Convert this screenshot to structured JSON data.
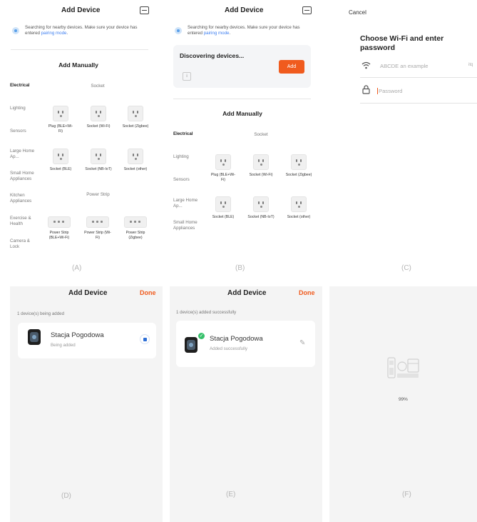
{
  "panel_a": {
    "title": "Add Device",
    "search_text": "Searching for nearby devices. Make sure your device has entered ",
    "pairing_link": "pairing mode",
    "period": ".",
    "add_manually": "Add Manually",
    "categories": [
      "Electrical",
      "Lighting",
      "Sensors",
      "Large Home Ap...",
      "Small Home Appliances",
      "Kitchen Appliances",
      "Exercise & Health",
      "Camera & Lock"
    ],
    "socket_header": "Socket",
    "power_strip_header": "Power Strip",
    "sockets": [
      "Plug (BLE+Wi-Fi)",
      "Socket (Wi-Fi)",
      "Socket (Zigbee)",
      "Socket (BLE)",
      "Socket (NB-IoT)",
      "Socket (other)"
    ],
    "strips": [
      "Power Strip (BLE+Wi-Fi)",
      "Power Strip (Wi-Fi)",
      "Power Strip (Zigbee)"
    ],
    "letter": "(A)"
  },
  "panel_b": {
    "title": "Add Device",
    "search_text": "Searching for nearby devices. Make sure your device has entered ",
    "pairing_link": "pairing mode",
    "period": ".",
    "discovering": "Discovering devices...",
    "add_button": "Add",
    "add_manually": "Add Manually",
    "categories": [
      "Electrical",
      "Lighting",
      "Sensors",
      "Large Home Ap...",
      "Small Home Appliances"
    ],
    "socket_header": "Socket",
    "sockets": [
      "Plug (BLE+Wi-Fi)",
      "Socket (Wi-Fi)",
      "Socket (Zigbee)",
      "Socket (BLE)",
      "Socket (NB-IoT)",
      "Socket (other)"
    ],
    "letter": "(B)"
  },
  "panel_c": {
    "cancel": "Cancel",
    "title": "Choose Wi-Fi and enter password",
    "wifi_value": "ABCDE an example",
    "wifi_suffix": "itq",
    "password_placeholder": "Password",
    "letter": "(C)"
  },
  "panel_d": {
    "title": "Add Device",
    "done": "Done",
    "note": "1 device(s) being added",
    "device_name": "Stacja Pogodowa",
    "status": "Being added",
    "letter": "(D)"
  },
  "panel_e": {
    "title": "Add Device",
    "done": "Done",
    "note": "1 device(s) added successfully",
    "device_name": "Stacja Pogodowa",
    "status": "Added successfully",
    "letter": "(E)"
  },
  "panel_f": {
    "percent": "99%",
    "progress": 0.99,
    "letter": "(F)"
  },
  "colors": {
    "accent": "#f05b1e",
    "link": "#3d7ef0",
    "success": "#36c06a",
    "panel_gray": "#f4f4f4"
  },
  "icons": [
    "scan-icon",
    "search-spinner-icon",
    "socket-icon",
    "power-strip-icon",
    "info-icon",
    "wifi-icon",
    "lock-icon",
    "watch-device-icon",
    "loading-icon",
    "check-icon",
    "edit-icon",
    "device-illustration-icon"
  ]
}
